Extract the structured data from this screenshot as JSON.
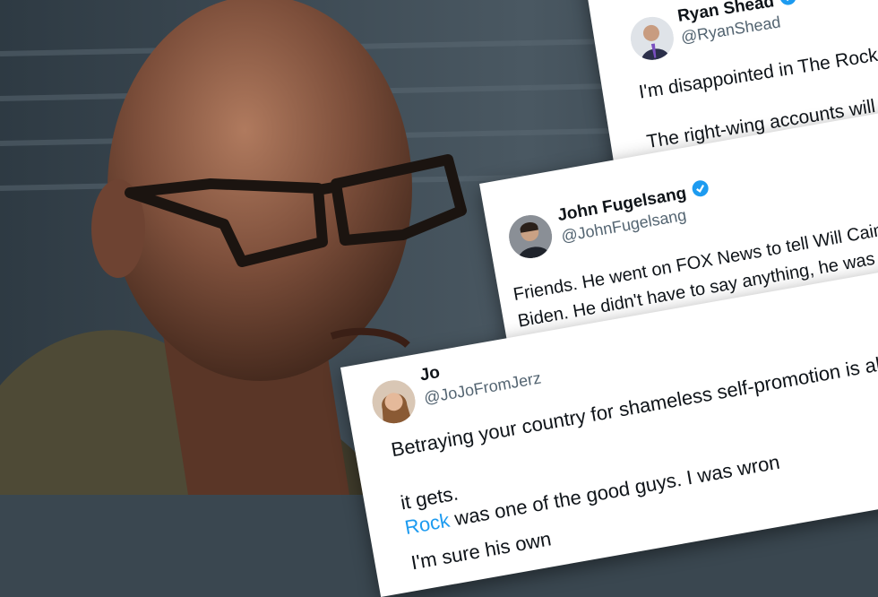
{
  "colors": {
    "background": "#3a4750",
    "card": "#ffffff",
    "text": "#0f1419",
    "handle": "#536471",
    "link": "#1d9bf0",
    "verified": "#1d9bf0"
  },
  "tweets": [
    {
      "name": "Ryan Shead",
      "handle": "@RyanShead",
      "verified": true,
      "lines": [
        "I'm disappointed in The Rock a",
        "The right-wing accounts will"
      ]
    },
    {
      "name": "John Fugelsang",
      "handle": "@JohnFugelsang",
      "verified": true,
      "lines": [
        "Friends.   He went on FOX News to tell Will Cain l",
        "Biden.   He didn't have to say anything, he was"
      ]
    },
    {
      "name": "Jo",
      "handle": "@JoJoFromJerz",
      "verified": false,
      "lines": [
        "Betraying your country for shameless self-promotion is abo",
        "it gets.",
        "was one of the good guys. I was wron",
        "I'm sure his own"
      ],
      "mention": "Rock"
    }
  ],
  "icons": [
    "verified-badge-icon",
    "avatar"
  ]
}
